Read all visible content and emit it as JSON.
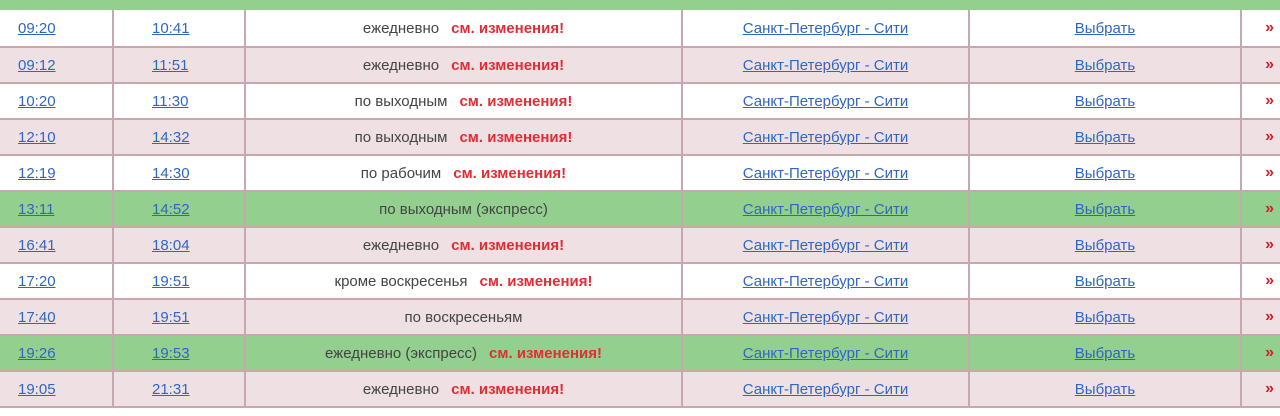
{
  "table": {
    "rows": [
      {
        "dep": "09:20",
        "arr": "10:41",
        "days": "ежедневно",
        "note": "см. изменения!",
        "route": "Санкт-Петербург - Сити",
        "choose": "Выбрать",
        "more": "»",
        "style": "white"
      },
      {
        "dep": "09:12",
        "arr": "11:51",
        "days": "ежедневно",
        "note": "см. изменения!",
        "route": "Санкт-Петербург - Сити",
        "choose": "Выбрать",
        "more": "»",
        "style": "pink"
      },
      {
        "dep": "10:20",
        "arr": "11:30",
        "days": "по выходным",
        "note": "см. изменения!",
        "route": "Санкт-Петербург - Сити",
        "choose": "Выбрать",
        "more": "»",
        "style": "white"
      },
      {
        "dep": "12:10",
        "arr": "14:32",
        "days": "по выходным",
        "note": "см. изменения!",
        "route": "Санкт-Петербург - Сити",
        "choose": "Выбрать",
        "more": "»",
        "style": "pink"
      },
      {
        "dep": "12:19",
        "arr": "14:30",
        "days": "по рабочим",
        "note": "см. изменения!",
        "route": "Санкт-Петербург - Сити",
        "choose": "Выбрать",
        "more": "»",
        "style": "white"
      },
      {
        "dep": "13:11",
        "arr": "14:52",
        "days": "по выходным (экспресс)",
        "note": "",
        "route": "Санкт-Петербург - Сити",
        "choose": "Выбрать",
        "more": "»",
        "style": "green"
      },
      {
        "dep": "16:41",
        "arr": "18:04",
        "days": "ежедневно",
        "note": "см. изменения!",
        "route": "Санкт-Петербург - Сити",
        "choose": "Выбрать",
        "more": "»",
        "style": "pink"
      },
      {
        "dep": "17:20",
        "arr": "19:51",
        "days": "кроме воскресенья",
        "note": "см. изменения!",
        "route": "Санкт-Петербург - Сити",
        "choose": "Выбрать",
        "more": "»",
        "style": "white"
      },
      {
        "dep": "17:40",
        "arr": "19:51",
        "days": "по воскресеньям",
        "note": "",
        "route": "Санкт-Петербург - Сити",
        "choose": "Выбрать",
        "more": "»",
        "style": "pink"
      },
      {
        "dep": "19:26",
        "arr": "19:53",
        "days": "ежедневно (экспресс)",
        "note": "см. изменения!",
        "route": "Санкт-Петербург - Сити",
        "choose": "Выбрать",
        "more": "»",
        "style": "green"
      },
      {
        "dep": "19:05",
        "arr": "21:31",
        "days": "ежедневно",
        "note": "см. изменения!",
        "route": "Санкт-Петербург - Сити",
        "choose": "Выбрать",
        "more": "»",
        "style": "pink"
      }
    ]
  }
}
